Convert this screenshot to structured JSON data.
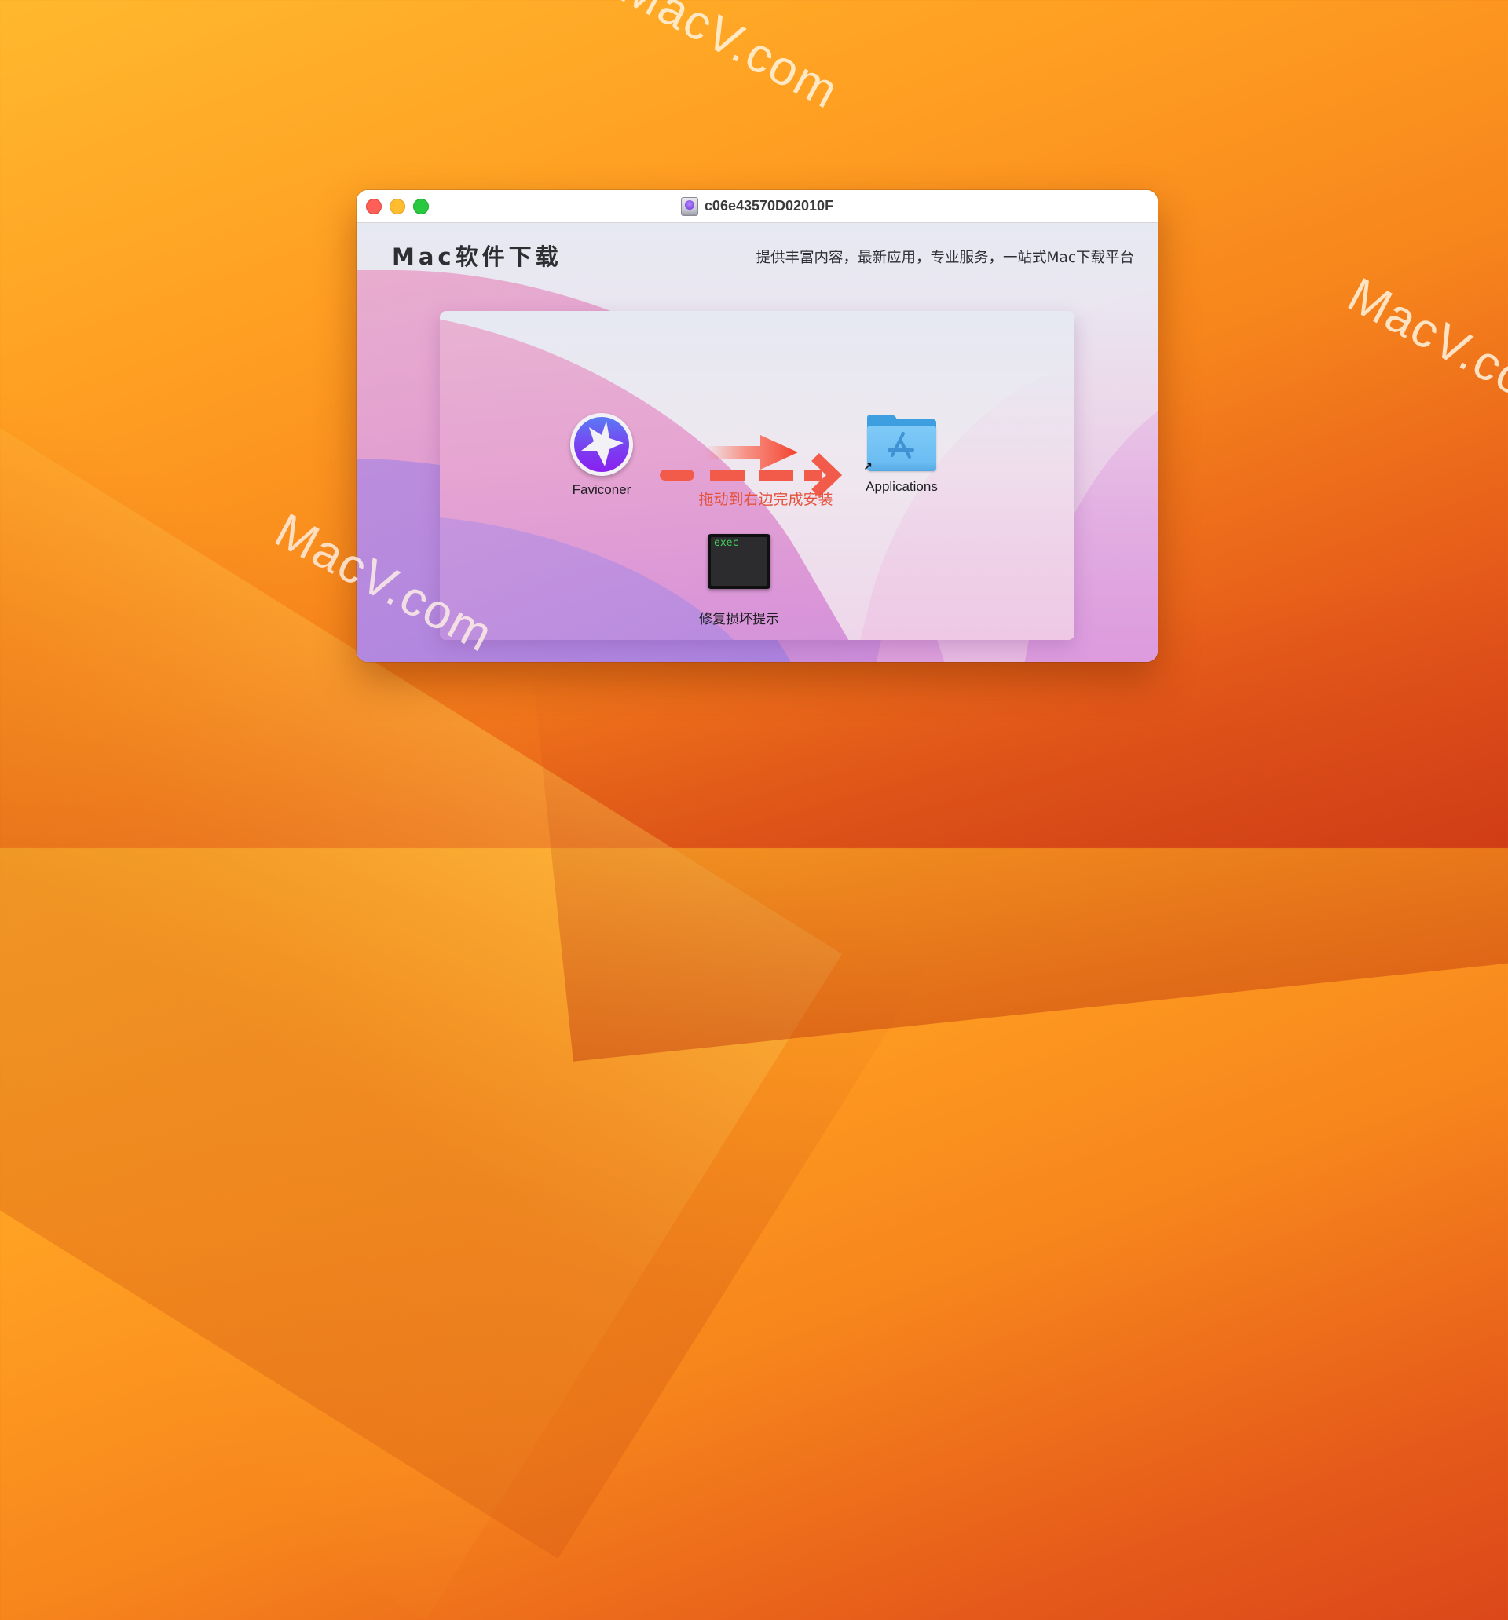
{
  "desktop": {
    "watermarks": [
      "MacV.com",
      "MacV.com",
      "MacV.com"
    ]
  },
  "window": {
    "title": "c06e43570D02010F",
    "title_icon": "disk-image-icon",
    "traffic_lights": {
      "close": "#fe5f57",
      "minimize": "#febc2e",
      "maximize": "#28c840"
    }
  },
  "header": {
    "brand": "Mac软件下载",
    "slogan": "提供丰富内容，最新应用，专业服务，一站式Mac下载平台"
  },
  "installer": {
    "app": {
      "label": "Faviconer",
      "icon": "star-app-icon"
    },
    "target": {
      "label": "Applications",
      "icon": "applications-folder-icon"
    },
    "hint": "拖动到右边完成安装",
    "hint_color": "#e4523c",
    "fix_tool": {
      "label": "修复损坏提示",
      "icon_text": "exec",
      "icon": "terminal-exec-icon"
    }
  }
}
